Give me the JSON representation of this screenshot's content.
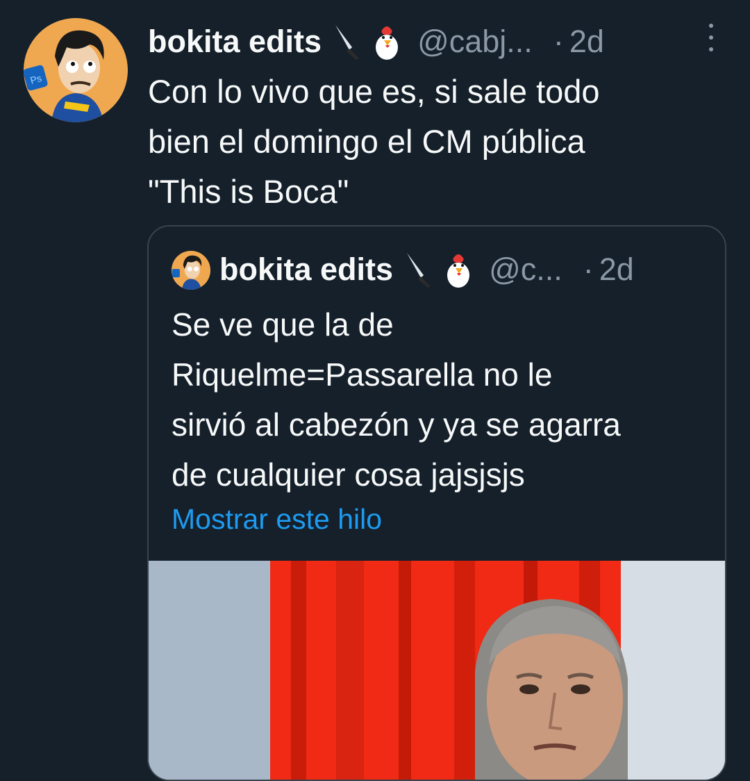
{
  "tweet": {
    "author_name": "bokita edits",
    "badges": [
      "knife-icon",
      "chicken-icon"
    ],
    "handle": "@cabj...",
    "separator": "·",
    "time": "2d",
    "text": "Con lo vivo que es, si sale todo\nbien el domingo el CM pública\n\"This is Boca\""
  },
  "quoted_tweet": {
    "author_name": "bokita edits",
    "badges": [
      "knife-icon",
      "chicken-icon"
    ],
    "handle": "@c...",
    "separator": "·",
    "time": "2d",
    "text": "Se ve que la de\nRiquelme=Passarella no le\nsirvió al cabezón y ya se agarra\nde cualquier cosa jajsjsjs",
    "show_thread_label": "Mostrar este hilo"
  },
  "colors": {
    "background": "#15202b",
    "text": "#f7f9f9",
    "secondary": "#8b98a5",
    "link": "#1d9bf0",
    "border": "#38444d"
  }
}
